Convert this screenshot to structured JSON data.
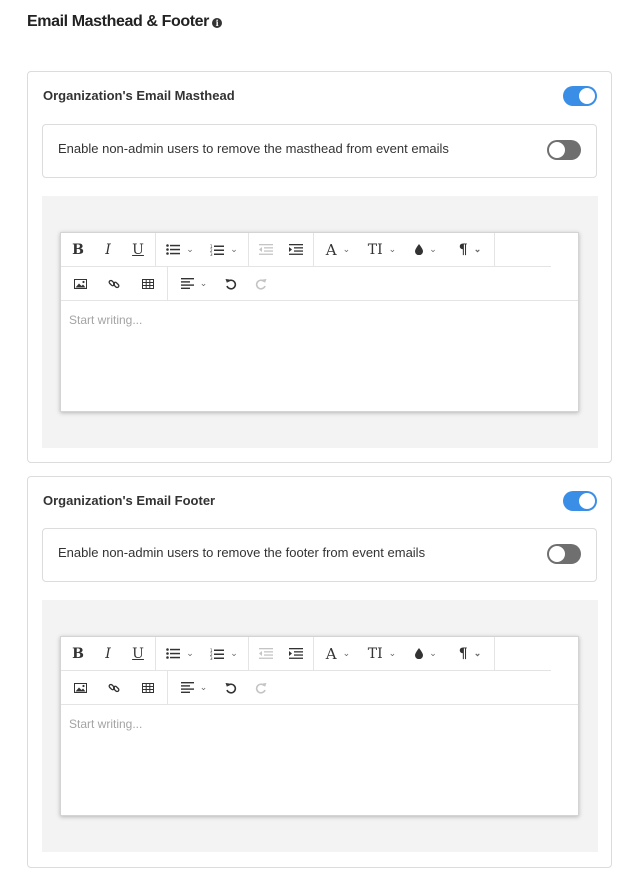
{
  "page": {
    "title": "Email Masthead & Footer",
    "info_icon": "info-icon"
  },
  "masthead": {
    "title": "Organization's Email Masthead",
    "enabled": true,
    "option_label": "Enable non-admin users to remove the masthead from event emails",
    "option_enabled": false,
    "editor_placeholder": "Start writing..."
  },
  "footer": {
    "title": "Organization's Email Footer",
    "enabled": true,
    "option_label": "Enable non-admin users to remove the footer from event emails",
    "option_enabled": false,
    "editor_placeholder": "Start writing..."
  },
  "toolbar": {
    "bold": "B",
    "italic": "I",
    "underline": "U",
    "font_family": "A",
    "font_size": "TI",
    "paragraph": "¶",
    "icons": [
      "bold-icon",
      "italic-icon",
      "underline-icon",
      "bullet-list-icon",
      "numbered-list-icon",
      "outdent-icon",
      "indent-icon",
      "font-family-icon",
      "font-size-icon",
      "text-color-icon",
      "paragraph-icon",
      "image-icon",
      "link-icon",
      "table-icon",
      "align-left-icon",
      "undo-icon",
      "redo-icon"
    ]
  },
  "colors": {
    "toggle_on": "#3a8ee6",
    "toggle_off": "#6f6f6f",
    "editor_bg": "#f3f3f3"
  }
}
